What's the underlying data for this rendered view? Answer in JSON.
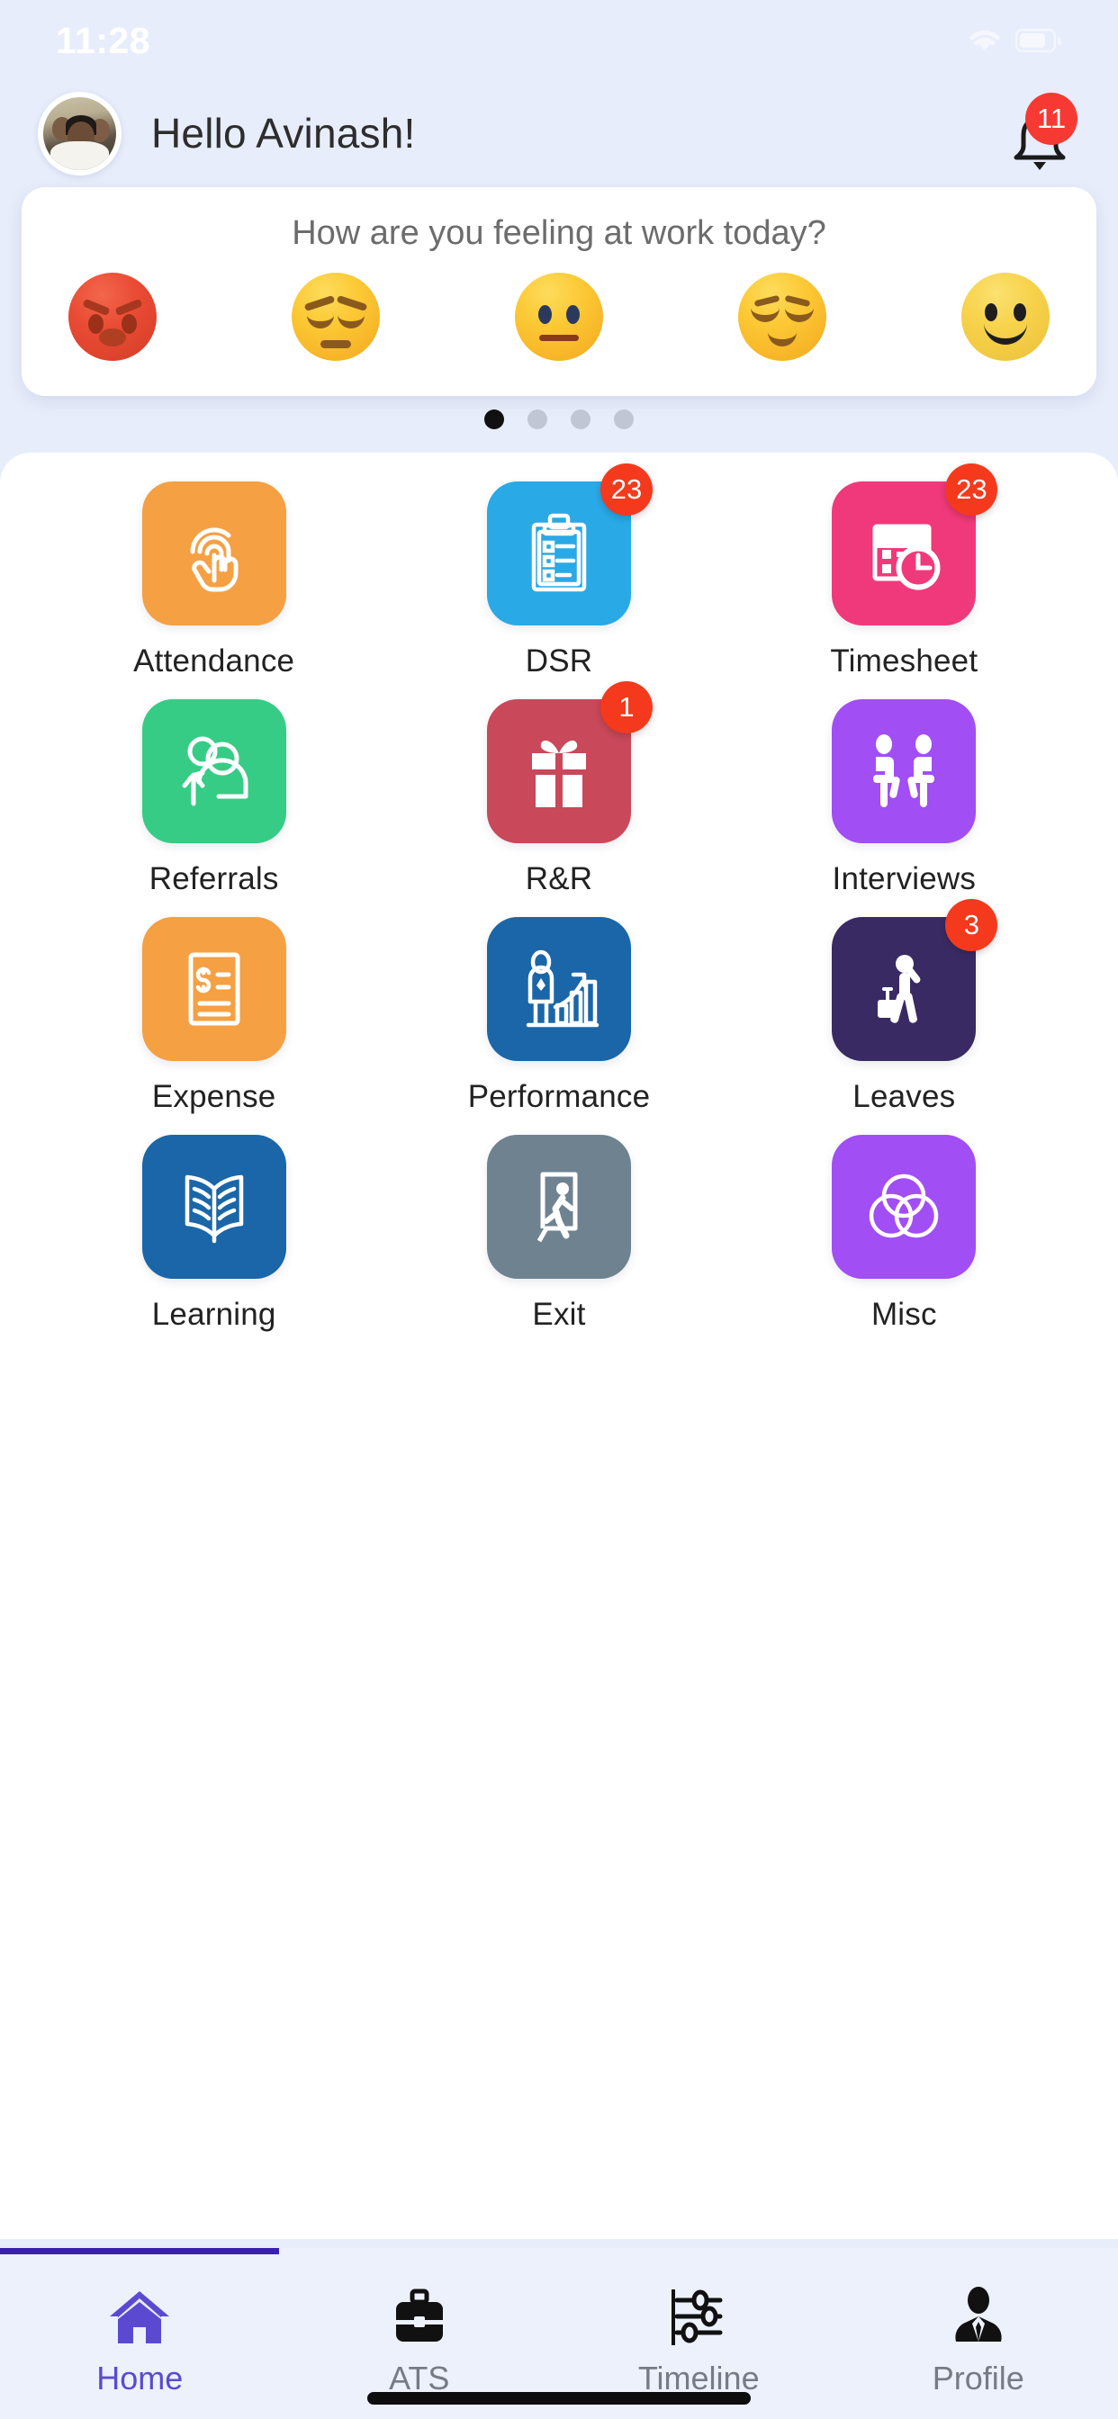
{
  "status_bar": {
    "time": "11:28",
    "wifi_icon": "wifi-icon",
    "battery_icon": "battery-icon"
  },
  "header": {
    "greeting": "Hello Avinash!",
    "avatar_name": "user-avatar",
    "bell_icon": "bell-icon",
    "notification_count": "11"
  },
  "mood_card": {
    "title": "How are you feeling at work today?",
    "options": [
      {
        "name": "angry",
        "emoji": "😡"
      },
      {
        "name": "pensive",
        "emoji": "😔"
      },
      {
        "name": "neutral",
        "emoji": "😐"
      },
      {
        "name": "relieved",
        "emoji": "😌"
      },
      {
        "name": "happy",
        "emoji": "🙂"
      }
    ]
  },
  "carousel": {
    "total_dots": 4,
    "active_index": 0
  },
  "apps": [
    {
      "label": "Attendance",
      "icon": "fingerprint-touch-icon",
      "color": "#f5a043",
      "badge": ""
    },
    {
      "label": "DSR",
      "icon": "clipboard-checklist-icon",
      "color": "#29a9e6",
      "badge": ""
    },
    {
      "label": "Timesheet",
      "icon": "document-clock-icon",
      "color": "#f0397a",
      "badge": "23"
    },
    {
      "label": "Referrals",
      "icon": "people-refer-icon",
      "color": "#36cc85",
      "badge": ""
    },
    {
      "label": "R&R",
      "icon": "gift-box-icon",
      "color": "#c9485a",
      "badge": "1"
    },
    {
      "label": "Interviews",
      "icon": "two-people-seated-icon",
      "color": "#a14ef5",
      "badge": ""
    },
    {
      "label": "Expense",
      "icon": "invoice-dollar-icon",
      "color": "#f5a043",
      "badge": ""
    },
    {
      "label": "Performance",
      "icon": "person-growth-chart-icon",
      "color": "#1a66a8",
      "badge": ""
    },
    {
      "label": "Leaves",
      "icon": "traveler-luggage-icon",
      "color": "#3a2a63",
      "badge": "3"
    },
    {
      "label": "Learning",
      "icon": "open-book-icon",
      "color": "#1a66a8",
      "badge": ""
    },
    {
      "label": "Exit",
      "icon": "exit-door-icon",
      "color": "#6f8290",
      "badge": ""
    },
    {
      "label": "Misc",
      "icon": "venn-circles-icon",
      "color": "#a14ef5",
      "badge": ""
    }
  ],
  "bottom_nav": {
    "items": [
      {
        "label": "Home",
        "icon": "home-icon",
        "active": true
      },
      {
        "label": "ATS",
        "icon": "briefcase-icon",
        "active": false
      },
      {
        "label": "Timeline",
        "icon": "sliders-icon",
        "active": false
      },
      {
        "label": "Profile",
        "icon": "person-suit-icon",
        "active": false
      }
    ],
    "active_color": "#5b4ad1",
    "indicator_color": "#3a1fb0"
  }
}
